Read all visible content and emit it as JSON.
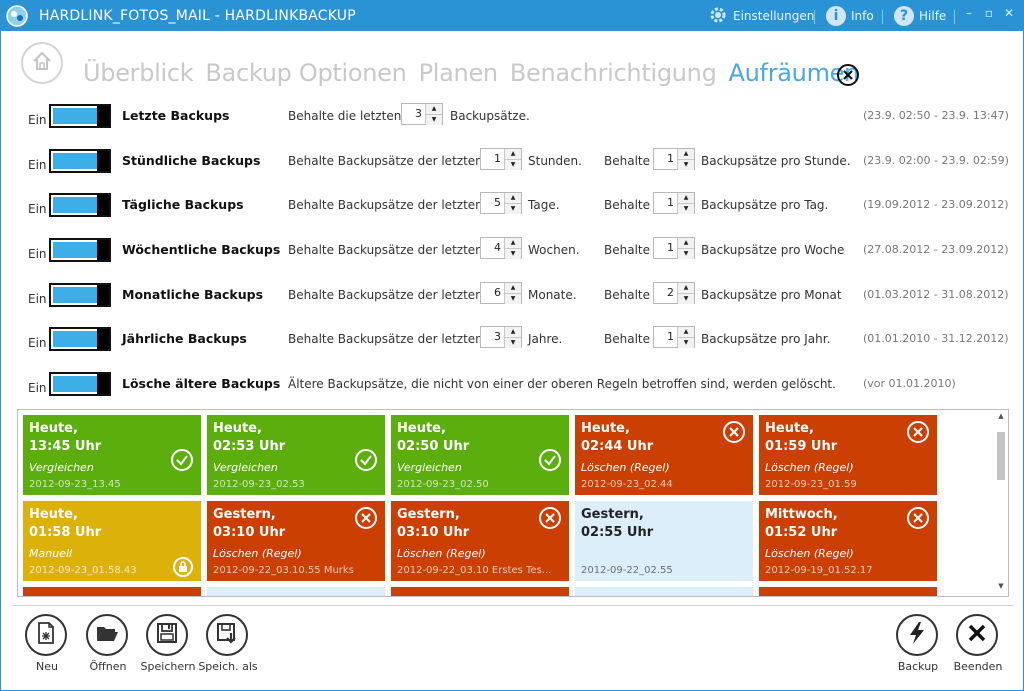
{
  "window": {
    "title": "HARDLINK_FOTOS_MAIL - HARDLINKBACKUP",
    "settings_label": "Einstellungen",
    "info_label": "Info",
    "help_label": "Hilfe",
    "info_glyph": "i",
    "help_glyph": "?",
    "minimize_glyph": "–",
    "maximize_glyph": "▫",
    "close_glyph": "✕",
    "accent_color": "#2a93d5"
  },
  "nav": {
    "tabs": [
      {
        "label": "Überblick"
      },
      {
        "label": "Backup Optionen"
      },
      {
        "label": "Planen"
      },
      {
        "label": "Benachrichtigung"
      },
      {
        "label": "Aufräumen"
      }
    ],
    "active_tab": "Aufräumen"
  },
  "rules": [
    {
      "state": "Ein",
      "name": "Letzte Backups",
      "pre": "Behalte die letzten",
      "value": "3",
      "unit": "Backupsätze.",
      "range": "(23.9. 02:50 - 23.9. 13:47)"
    },
    {
      "state": "Ein",
      "name": "Stündliche Backups",
      "pre": "Behalte Backupsätze der letzten",
      "value": "1",
      "unit": "Stunden.",
      "keep_label": "Behalte",
      "keep_value": "1",
      "keep_unit": "Backupsätze pro Stunde.",
      "range": "(23.9. 02:00 - 23.9. 02:59)"
    },
    {
      "state": "Ein",
      "name": "Tägliche Backups",
      "pre": "Behalte Backupsätze der letzten",
      "value": "5",
      "unit": "Tage.",
      "keep_label": "Behalte",
      "keep_value": "1",
      "keep_unit": "Backupsätze pro Tag.",
      "range": "(19.09.2012 - 23.09.2012)"
    },
    {
      "state": "Ein",
      "name": "Wöchentliche Backups",
      "pre": "Behalte Backupsätze der letzten",
      "value": "4",
      "unit": "Wochen.",
      "keep_label": "Behalte",
      "keep_value": "1",
      "keep_unit": "Backupsätze pro Woche",
      "range": "(27.08.2012 - 23.09.2012)"
    },
    {
      "state": "Ein",
      "name": "Monatliche Backups",
      "pre": "Behalte Backupsätze der letzten",
      "value": "6",
      "unit": "Monate.",
      "keep_label": "Behalte",
      "keep_value": "2",
      "keep_unit": "Backupsätze pro Monat",
      "range": "(01.03.2012 - 31.08.2012)"
    },
    {
      "state": "Ein",
      "name": "Jährliche Backups",
      "pre": "Behalte Backupsätze der letzten",
      "value": "3",
      "unit": "Jahre.",
      "keep_label": "Behalte",
      "keep_value": "1",
      "keep_unit": "Backupsätze pro Jahr.",
      "range": "(01.01.2010 - 31.12.2012)"
    },
    {
      "state": "Ein",
      "name": "Lösche ältere Backups",
      "pre": "Ältere Backupsätze, die nicht von einer der oberen Regeln betroffen sind, werden gelöscht.",
      "range": "(vor 01.01.2010)"
    }
  ],
  "backups": [
    {
      "day": "Heute,",
      "time": "13:45 Uhr",
      "action": "Vergleichen",
      "id": "2012-09-23_13.45",
      "color": "green",
      "icon": "check-icon"
    },
    {
      "day": "Heute,",
      "time": "02:53 Uhr",
      "action": "Vergleichen",
      "id": "2012-09-23_02.53",
      "color": "green",
      "icon": "check-icon"
    },
    {
      "day": "Heute,",
      "time": "02:50 Uhr",
      "action": "Vergleichen",
      "id": "2012-09-23_02.50",
      "color": "green",
      "icon": "check-icon"
    },
    {
      "day": "Heute,",
      "time": "02:44 Uhr",
      "action": "Löschen (Regel)",
      "id": "2012-09-23_02.44",
      "color": "red",
      "icon": "delete-icon"
    },
    {
      "day": "Heute,",
      "time": "01:59 Uhr",
      "action": "Löschen (Regel)",
      "id": "2012-09-23_01.59",
      "color": "red",
      "icon": "delete-icon"
    },
    {
      "day": "Heute,",
      "time": "01:58 Uhr",
      "action": "Manuell",
      "id": "2012-09-23_01.58.43",
      "color": "yellow",
      "icon": "lock-icon"
    },
    {
      "day": "Gestern,",
      "time": "03:10 Uhr",
      "action": "Löschen (Regel)",
      "id": "2012-09-22_03.10.55 Murks",
      "color": "red",
      "icon": "delete-icon"
    },
    {
      "day": "Gestern,",
      "time": "03:10 Uhr",
      "action": "Löschen (Regel)",
      "id": "2012-09-22_03.10 Erstes Tes...",
      "color": "red",
      "icon": "delete-icon"
    },
    {
      "day": "Gestern,",
      "time": "02:55 Uhr",
      "action": "",
      "id": "2012-09-22_02.55",
      "color": "light",
      "icon": ""
    },
    {
      "day": "Mittwoch,",
      "time": "01:52 Uhr",
      "action": "Löschen (Regel)",
      "id": "2012-09-19_01.52.17",
      "color": "red",
      "icon": "delete-icon"
    },
    {
      "color": "red"
    },
    {
      "color": "light"
    },
    {
      "color": "red"
    },
    {
      "color": "light"
    },
    {
      "color": "red"
    }
  ],
  "toolbar": {
    "new_label": "Neu",
    "open_label": "Öffnen",
    "save_label": "Speichern",
    "save_as_label": "Speich. als",
    "backup_label": "Backup",
    "exit_label": "Beenden"
  }
}
